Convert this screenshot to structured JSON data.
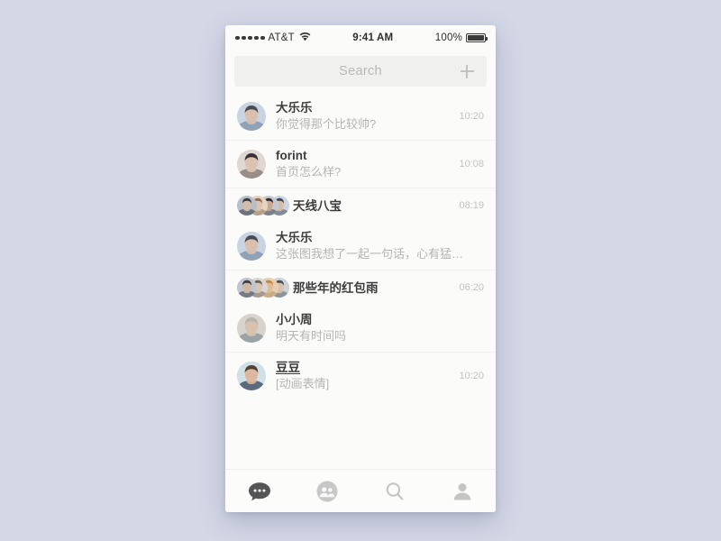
{
  "background_color": "#d3d7e6",
  "screen_color": "#fbfbfa",
  "status_bar": {
    "carrier": "AT&T",
    "signal_icon": "signal-dots-icon",
    "wifi_icon": "wifi-icon",
    "time": "9:41 AM",
    "battery_percent": "100%",
    "battery_icon": "battery-full-icon"
  },
  "search": {
    "placeholder": "Search",
    "value": "",
    "add_icon": "plus-icon"
  },
  "sections": [
    {
      "rows": [
        {
          "type": "chat",
          "avatar": "avatar-man-phone",
          "name": "大乐乐",
          "preview": "你觉得那个比较帅?",
          "time": "10:20",
          "underline": false
        }
      ]
    },
    {
      "rows": [
        {
          "type": "chat",
          "avatar": "avatar-woman-dark-hair",
          "name": "forint",
          "preview": "首页怎么样?",
          "time": "10:08",
          "underline": false
        }
      ]
    },
    {
      "rows": [
        {
          "type": "group",
          "avatars": [
            "avatar-a",
            "avatar-b",
            "avatar-c",
            "avatar-d"
          ],
          "name": "天线八宝",
          "time": "08:19"
        },
        {
          "type": "chat",
          "avatar": "avatar-man-phone",
          "name": "大乐乐",
          "preview": "这张图我想了一起一句话，心有猛…",
          "time": "",
          "underline": false
        }
      ]
    },
    {
      "rows": [
        {
          "type": "group",
          "avatars": [
            "avatar-e",
            "avatar-f",
            "avatar-g",
            "avatar-h"
          ],
          "name": "那些年的红包雨",
          "time": "06:20"
        },
        {
          "type": "chat",
          "avatar": "avatar-older-man",
          "name": "小小周",
          "preview": "明天有时间吗",
          "time": "",
          "underline": false
        }
      ]
    },
    {
      "rows": [
        {
          "type": "chat",
          "avatar": "avatar-bearded-man",
          "name": "豆豆",
          "preview": "[动画表情]",
          "time": "10:20",
          "underline": true
        }
      ]
    }
  ],
  "tab_bar": {
    "tabs": [
      {
        "icon": "chat-bubble-icon",
        "label": "Chats",
        "active": true
      },
      {
        "icon": "contacts-icon",
        "label": "Contacts",
        "active": false
      },
      {
        "icon": "search-icon",
        "label": "Discover",
        "active": false
      },
      {
        "icon": "profile-icon",
        "label": "Me",
        "active": false
      }
    ],
    "active_color": "#555555",
    "inactive_color": "#c5c5c5"
  }
}
